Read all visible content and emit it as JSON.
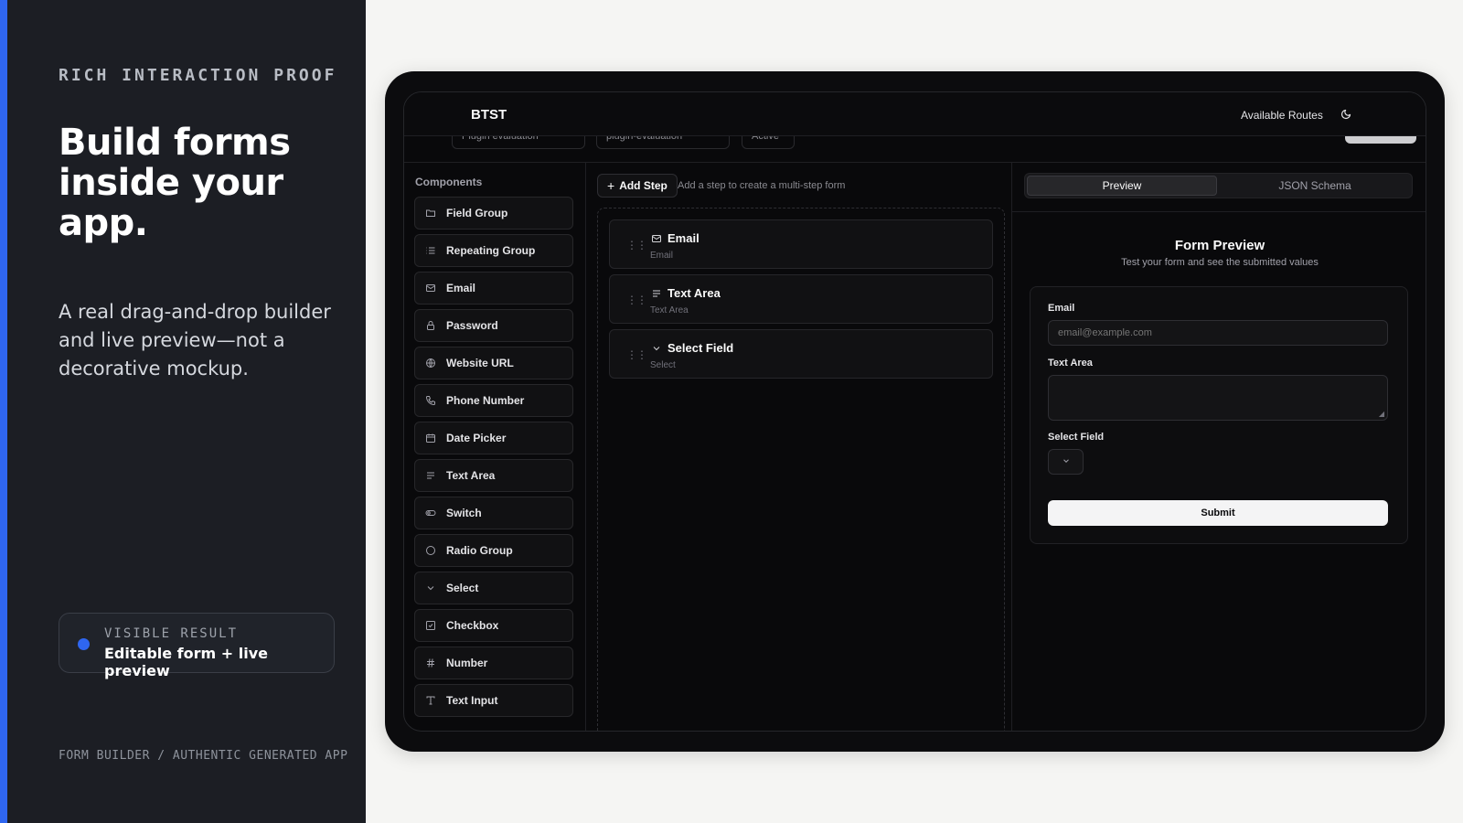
{
  "promo": {
    "eyebrow": "RICH INTERACTION PROOF",
    "headline": "Build forms inside your app.",
    "subtitle": "A real drag-and-drop builder and live preview—not a decorative mockup.",
    "result_label": "VISIBLE RESULT",
    "result_value": "Editable form + live preview",
    "footer": "FORM BUILDER / AUTHENTIC GENERATED APP",
    "accent_color": "#2f66f0"
  },
  "app": {
    "brand": "BTST",
    "routes_label": "Available Routes",
    "theme_icon": "moon-icon",
    "ghost_controls": [
      "Plugin evaluation",
      "plugin-evaluation",
      "Active"
    ]
  },
  "components": {
    "title": "Components",
    "items": [
      {
        "label": "Field Group",
        "icon": "folder-icon"
      },
      {
        "label": "Repeating Group",
        "icon": "list-icon"
      },
      {
        "label": "Email",
        "icon": "mail-icon"
      },
      {
        "label": "Password",
        "icon": "lock-icon"
      },
      {
        "label": "Website URL",
        "icon": "globe-icon"
      },
      {
        "label": "Phone Number",
        "icon": "phone-icon"
      },
      {
        "label": "Date Picker",
        "icon": "calendar-icon"
      },
      {
        "label": "Text Area",
        "icon": "text-align-icon"
      },
      {
        "label": "Switch",
        "icon": "toggle-icon"
      },
      {
        "label": "Radio Group",
        "icon": "circle-icon"
      },
      {
        "label": "Select",
        "icon": "chevron-down-icon"
      },
      {
        "label": "Checkbox",
        "icon": "checkbox-icon"
      },
      {
        "label": "Number",
        "icon": "hash-icon"
      },
      {
        "label": "Text Input",
        "icon": "type-icon"
      }
    ]
  },
  "canvas": {
    "add_step": "Add Step",
    "hint": "Add a step to create a multi-step form",
    "fields": [
      {
        "name": "Email",
        "type": "Email",
        "icon": "mail-icon"
      },
      {
        "name": "Text Area",
        "type": "Text Area",
        "icon": "text-align-icon"
      },
      {
        "name": "Select Field",
        "type": "Select",
        "icon": "chevron-down-icon"
      }
    ]
  },
  "preview": {
    "tabs": [
      "Preview",
      "JSON Schema"
    ],
    "title": "Form Preview",
    "subtitle": "Test your form and see the submitted values",
    "email_label": "Email",
    "email_placeholder": "email@example.com",
    "textarea_label": "Text Area",
    "select_label": "Select Field",
    "submit_label": "Submit"
  }
}
